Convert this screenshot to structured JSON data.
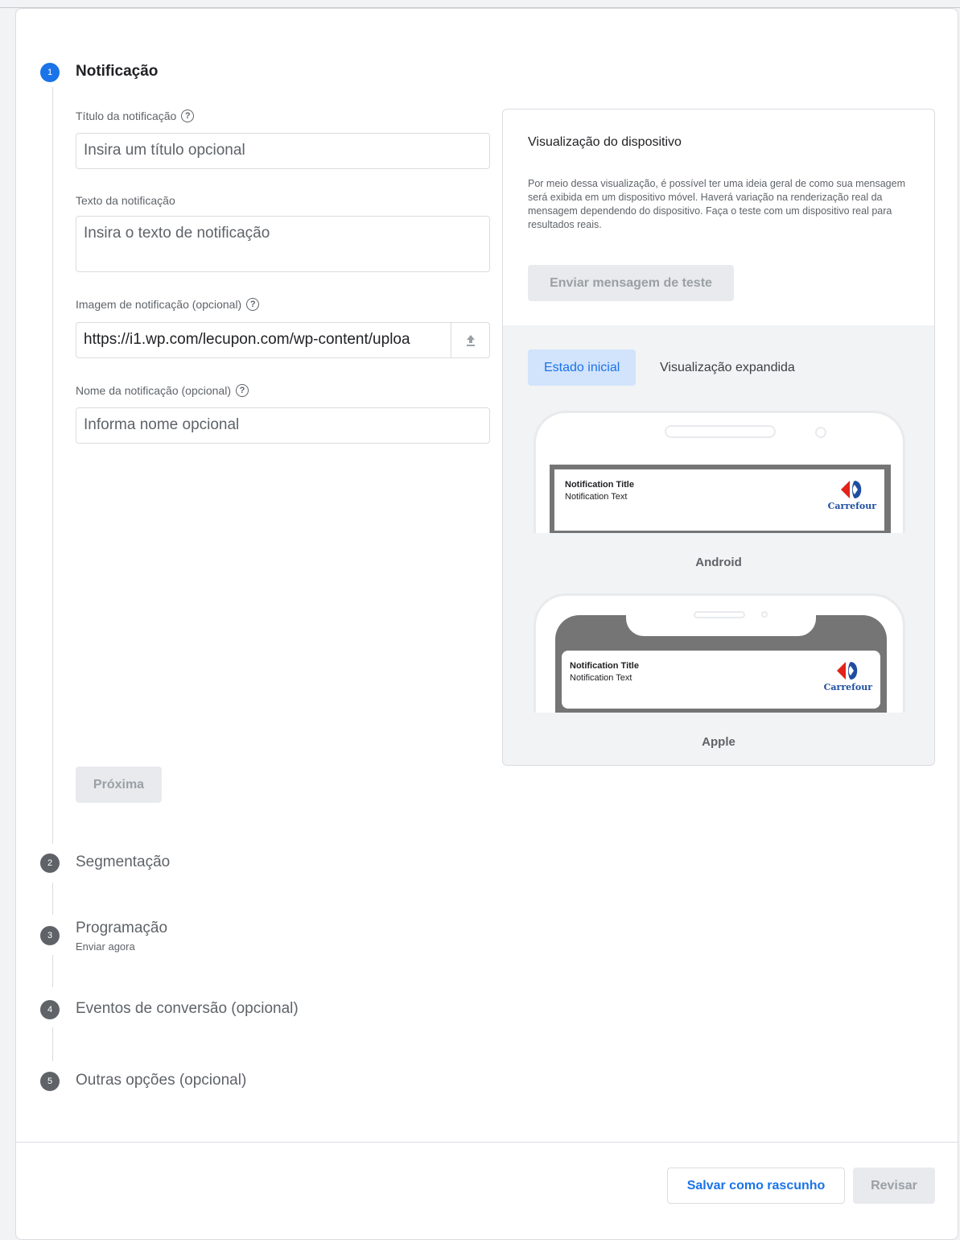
{
  "steps": [
    {
      "number": "1",
      "title": "Notificação",
      "subtitle": ""
    },
    {
      "number": "2",
      "title": "Segmentação",
      "subtitle": ""
    },
    {
      "number": "3",
      "title": "Programação",
      "subtitle": "Enviar agora"
    },
    {
      "number": "4",
      "title": "Eventos de conversão (opcional)",
      "subtitle": ""
    },
    {
      "number": "5",
      "title": "Outras opções (opcional)",
      "subtitle": ""
    }
  ],
  "form": {
    "title_label": "Título da notificação",
    "title_placeholder": "Insira um título opcional",
    "text_label": "Texto da notificação",
    "text_placeholder": "Insira o texto de notificação",
    "image_label": "Imagem de notificação (opcional)",
    "image_value": "https://i1.wp.com/lecupon.com/wp-content/uploa",
    "name_label": "Nome da notificação (opcional)",
    "name_placeholder": "Informa nome opcional",
    "next_label": "Próxima"
  },
  "preview": {
    "title": "Visualização do dispositivo",
    "description": "Por meio dessa visualização, é possível ter uma ideia geral de como sua mensagem será exibida em um dispositivo móvel. Haverá variação na renderização real da mensagem dependendo do dispositivo. Faça o teste com um dispositivo real para resultados reais.",
    "send_test_label": "Enviar mensagem de teste",
    "tabs": [
      "Estado inicial",
      "Visualização expandida"
    ],
    "notification_title": "Notification Title",
    "notification_text": "Notification Text",
    "brand": "Carrefour",
    "android_label": "Android",
    "apple_label": "Apple"
  },
  "footer": {
    "save_draft_label": "Salvar como rascunho",
    "review_label": "Revisar"
  },
  "colors": {
    "accent": "#1a73e8",
    "carrefour_red": "#e2231a",
    "carrefour_blue": "#1f4ea0"
  }
}
